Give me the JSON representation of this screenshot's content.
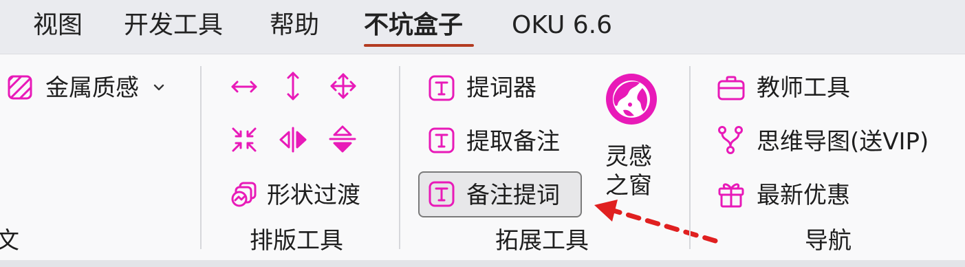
{
  "menu": {
    "items": [
      "视图",
      "开发工具",
      "帮助",
      "不坑盒子",
      "OKU 6.6"
    ],
    "active_index": 3,
    "active_underline_color": "#b33b21"
  },
  "group_partial": {
    "metal_label": "金属质感",
    "caption_fragment": "文"
  },
  "layout_group": {
    "label": "排版工具",
    "icons": [
      "stretch-horizontal-icon",
      "stretch-vertical-icon",
      "move-arrows-icon",
      "shrink-icon",
      "flip-horizontal-icon",
      "flip-vertical-icon"
    ],
    "shape_transition_label": "形状过渡"
  },
  "extension_group": {
    "label": "拓展工具",
    "prompter_label": "提词器",
    "extract_notes_label": "提取备注",
    "notes_prompt_label": "备注提词",
    "inspiration_line1": "灵感",
    "inspiration_line2": "之窗"
  },
  "nav_group": {
    "label": "导航",
    "teacher_tools_label": "教师工具",
    "mindmap_label": "思维导图(送VIP)",
    "offers_label": "最新优惠"
  },
  "colors": {
    "accent": "#e81ab8",
    "arrow": "#e02020"
  }
}
